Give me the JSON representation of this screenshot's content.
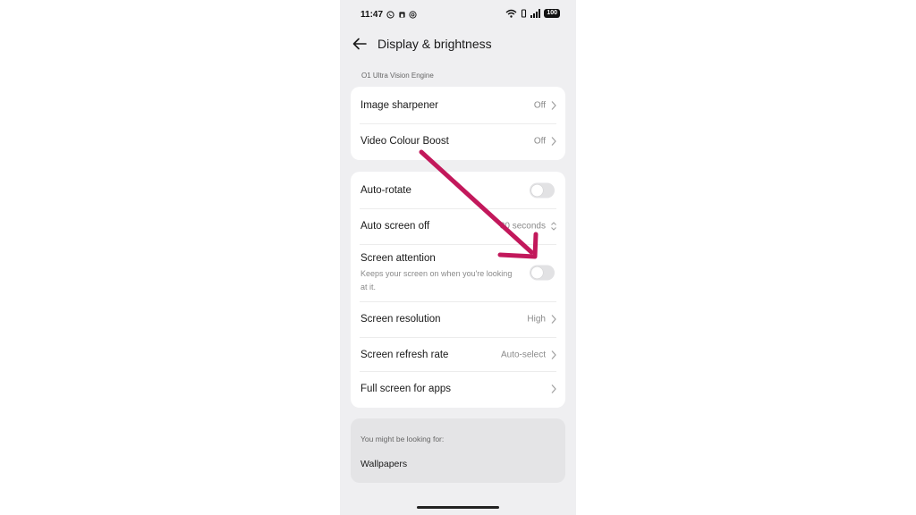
{
  "status_bar": {
    "time": "11:47",
    "notification_icons": [
      "whatsapp-icon",
      "app-icon",
      "at-icon"
    ],
    "battery": "100"
  },
  "header": {
    "title": "Display & brightness"
  },
  "section_label": "O1 Ultra Vision Engine",
  "card1": {
    "items": [
      {
        "label": "Image sharpener",
        "value": "Off"
      },
      {
        "label": "Video Colour Boost",
        "value": "Off"
      }
    ]
  },
  "card2": {
    "auto_rotate": {
      "label": "Auto-rotate",
      "on": false
    },
    "auto_screen_off": {
      "label": "Auto screen off",
      "value": "30 seconds"
    },
    "screen_attention": {
      "label": "Screen attention",
      "sub": "Keeps your screen on when you're looking at it.",
      "on": false
    },
    "screen_resolution": {
      "label": "Screen resolution",
      "value": "High"
    },
    "screen_refresh_rate": {
      "label": "Screen refresh rate",
      "value": "Auto-select"
    },
    "full_screen_apps": {
      "label": "Full screen for apps"
    }
  },
  "suggest": {
    "heading": "You might be looking for:",
    "link": "Wallpapers"
  },
  "colors": {
    "annotation_arrow": "#c2185b",
    "background": "#efeff1",
    "card": "#ffffff"
  }
}
